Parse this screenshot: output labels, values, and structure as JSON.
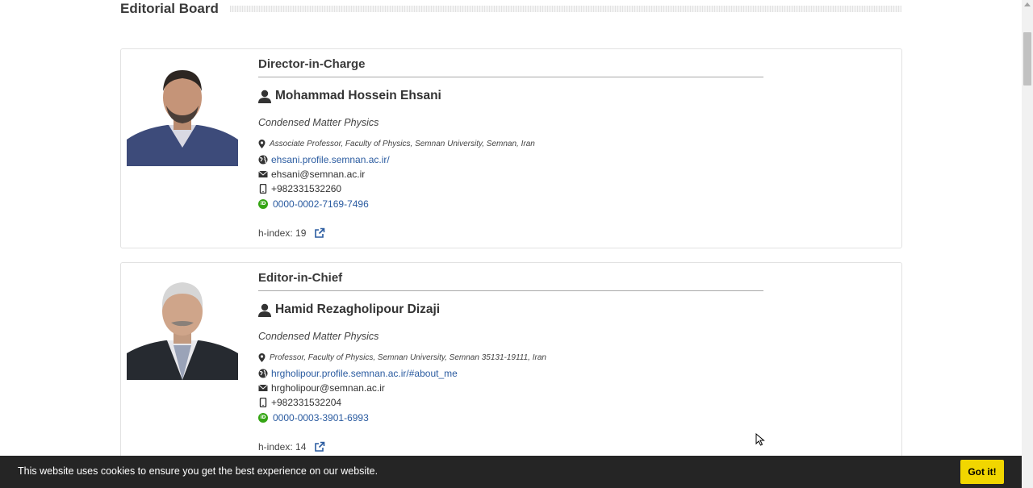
{
  "section": {
    "title": "Editorial Board"
  },
  "members": [
    {
      "role": "Director-in-Charge",
      "name": "Mohammad Hossein Ehsani",
      "field": "Condensed Matter Physics",
      "affiliation": "Associate Professor, Faculty of Physics, Semnan University, Semnan, Iran",
      "website": "ehsani.profile.semnan.ac.ir/",
      "email": "ehsani@semnan.ac.ir",
      "phone": "+982331532260",
      "orcid": "0000-0002-7169-7496",
      "hindex": "h-index: 19"
    },
    {
      "role": "Editor-in-Chief",
      "name": "Hamid Rezagholipour Dizaji",
      "field": "Condensed Matter Physics",
      "affiliation": "Professor, Faculty of Physics, Semnan University, Semnan 35131-19111, Iran",
      "website": "hrgholipour.profile.semnan.ac.ir/#about_me",
      "email": "hrgholipour@semnan.ac.ir",
      "phone": "+982331532204",
      "orcid": "0000-0003-3901-6993",
      "hindex": "h-index: 14"
    }
  ],
  "cookie": {
    "message": "This website uses cookies to ensure you get the best experience on our website.",
    "button": "Got it!"
  },
  "icons": {
    "person": "person-icon",
    "location": "map-marker-icon",
    "globe": "globe-icon",
    "email": "envelope-icon",
    "phone": "mobile-phone-icon",
    "orcid": "orcid-icon",
    "external": "external-link-icon"
  },
  "colors": {
    "link": "#2a5ba0",
    "cookie_bar": "#252525",
    "cookie_button": "#f1d600",
    "orcid": "#35a514"
  }
}
